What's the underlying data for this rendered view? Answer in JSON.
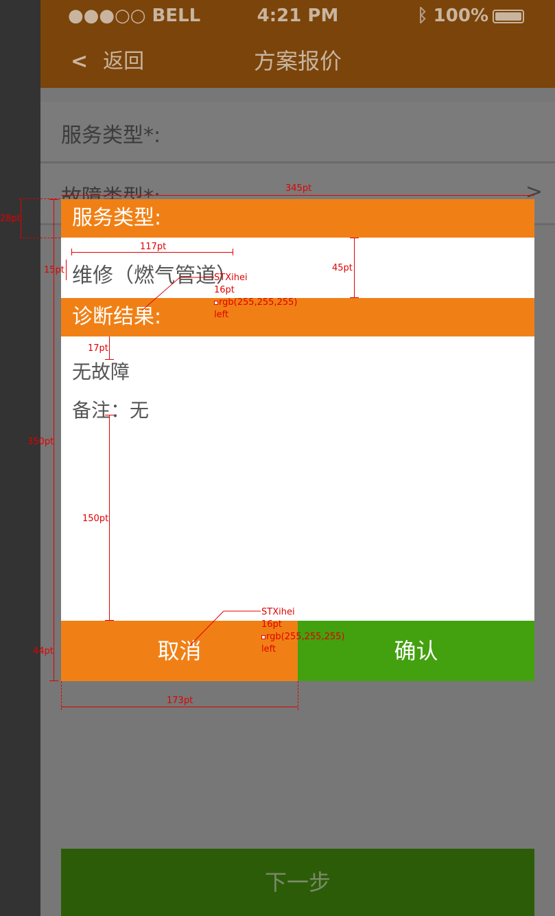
{
  "status_bar": {
    "carrier": "●●●○○ BELL",
    "time": "4:21 PM",
    "battery": "100%"
  },
  "nav": {
    "back_label": "返回",
    "title": "方案报价"
  },
  "background_form": {
    "rows": [
      {
        "label": "服务类型*:"
      },
      {
        "label": "故障类型*:"
      }
    ],
    "next_button": "下一步"
  },
  "dialog": {
    "service_header": "服务类型:",
    "service_value": "维修（燃气管道）",
    "result_header": "诊断结果:",
    "result_value": "无故障",
    "note": "备注：无",
    "cancel_label": "取消",
    "confirm_label": "确认",
    "colors": {
      "header": "#f08015",
      "cancel": "#f08015",
      "confirm": "#43a10f"
    }
  },
  "annotations": {
    "width_total": "345pt",
    "header_height": "28pt",
    "service_width": "117pt",
    "service_top": "15pt",
    "service_block": "45pt",
    "font_name": "STXihei",
    "font_size": "16pt",
    "font_color": "rgb(255,255,255)",
    "font_align": "left",
    "result_gap": "17pt",
    "dialog_height": "350pt",
    "note_gap": "150pt",
    "button_height": "44pt",
    "button_width": "173pt"
  }
}
